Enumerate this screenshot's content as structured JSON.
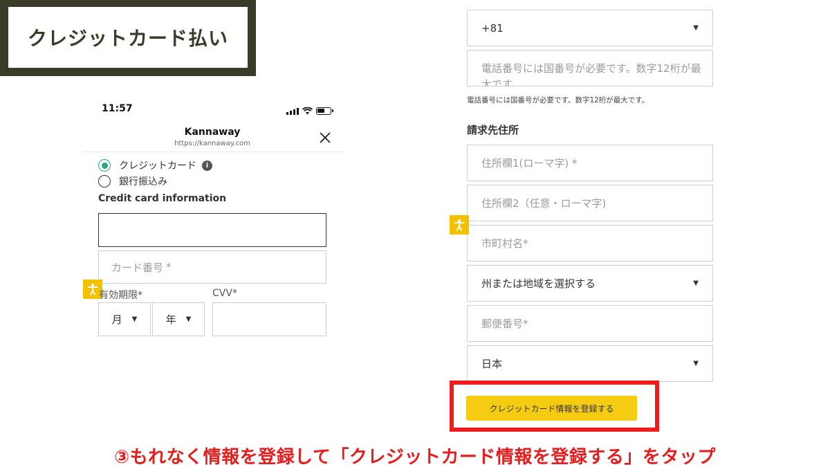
{
  "title": "クレジットカード払い",
  "status_bar": {
    "time": "11:57"
  },
  "browser": {
    "site_name": "Kannaway",
    "url": "https://kannaway.com"
  },
  "payment_methods": [
    {
      "label": "クレジットカード",
      "selected": true
    },
    {
      "label": "銀行振込み",
      "selected": false
    }
  ],
  "card_section": {
    "heading": "Credit card information",
    "card_number_placeholder": "カード番号",
    "required_mark": "*",
    "expiry_label": "有効期限",
    "cvv_label": "CVV",
    "month_select": "月",
    "year_select": "年"
  },
  "right_form": {
    "country_code": "+81",
    "phone_placeholder": "電話番号には国番号が必要です。数字12桁が最大です。",
    "phone_help": "電話番号には国番号が必要です。数字12桁が最大です。",
    "billing_heading": "請求先住所",
    "address1_placeholder": "住所欄1(ローマ字)",
    "address2_placeholder": "住所欄2（任意・ローマ字)",
    "city_placeholder": "市町村名",
    "state_select": "州または地域を選択する",
    "postal_placeholder": "郵便番号",
    "country_select": "日本",
    "required_mark": "*"
  },
  "submit_button": "クレジットカード情報を登録する",
  "caption": "③もれなく情報を登録して「クレジットカード情報を登録する」をタップ",
  "colors": {
    "accent_yellow": "#f6cc12",
    "highlight_red": "#ee1c1c",
    "radio_green": "#2aa58a",
    "title_dark": "#3b3b29"
  }
}
